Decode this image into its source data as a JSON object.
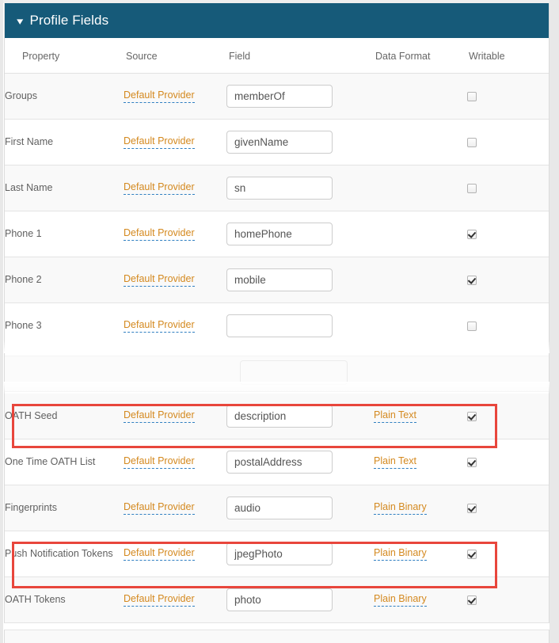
{
  "panel": {
    "title": "Profile Fields",
    "collapse_icon": "chevron-down-icon",
    "accent_color": "#165a79",
    "link_color": "#d4891f",
    "link_underline_color": "#2f7fc1",
    "highlight_color": "#e8463c"
  },
  "columns": {
    "property": "Property",
    "source": "Source",
    "field": "Field",
    "data_format": "Data Format",
    "writable": "Writable"
  },
  "section_top": {
    "rows": [
      {
        "property": "Groups",
        "source": "Default Provider",
        "field_value": "memberOf",
        "data_format": "",
        "writable": false
      },
      {
        "property": "First Name",
        "source": "Default Provider",
        "field_value": "givenName",
        "data_format": "",
        "writable": false
      },
      {
        "property": "Last Name",
        "source": "Default Provider",
        "field_value": "sn",
        "data_format": "",
        "writable": false
      },
      {
        "property": "Phone 1",
        "source": "Default Provider",
        "field_value": "homePhone",
        "data_format": "",
        "writable": true
      },
      {
        "property": "Phone 2",
        "source": "Default Provider",
        "field_value": "mobile",
        "data_format": "",
        "writable": true
      },
      {
        "property": "Phone 3",
        "source": "Default Provider",
        "field_value": "",
        "data_format": "",
        "writable": false
      }
    ]
  },
  "section_bottom": {
    "rows": [
      {
        "property": "OATH Seed",
        "source": "Default Provider",
        "field_value": "description",
        "data_format": "Plain Text",
        "writable": true,
        "highlighted": true
      },
      {
        "property": "One Time OATH List",
        "source": "Default Provider",
        "field_value": "postalAddress",
        "data_format": "Plain Text",
        "writable": true,
        "highlighted": false
      },
      {
        "property": "Fingerprints",
        "source": "Default Provider",
        "field_value": "audio",
        "data_format": "Plain Binary",
        "writable": true,
        "highlighted": false
      },
      {
        "property": "Push Notification Tokens",
        "source": "Default Provider",
        "field_value": "jpegPhoto",
        "data_format": "Plain Binary",
        "writable": true,
        "highlighted": true
      },
      {
        "property": "OATH Tokens",
        "source": "Default Provider",
        "field_value": "photo",
        "data_format": "Plain Binary",
        "writable": true,
        "highlighted": false
      }
    ]
  },
  "input_placeholder": ""
}
